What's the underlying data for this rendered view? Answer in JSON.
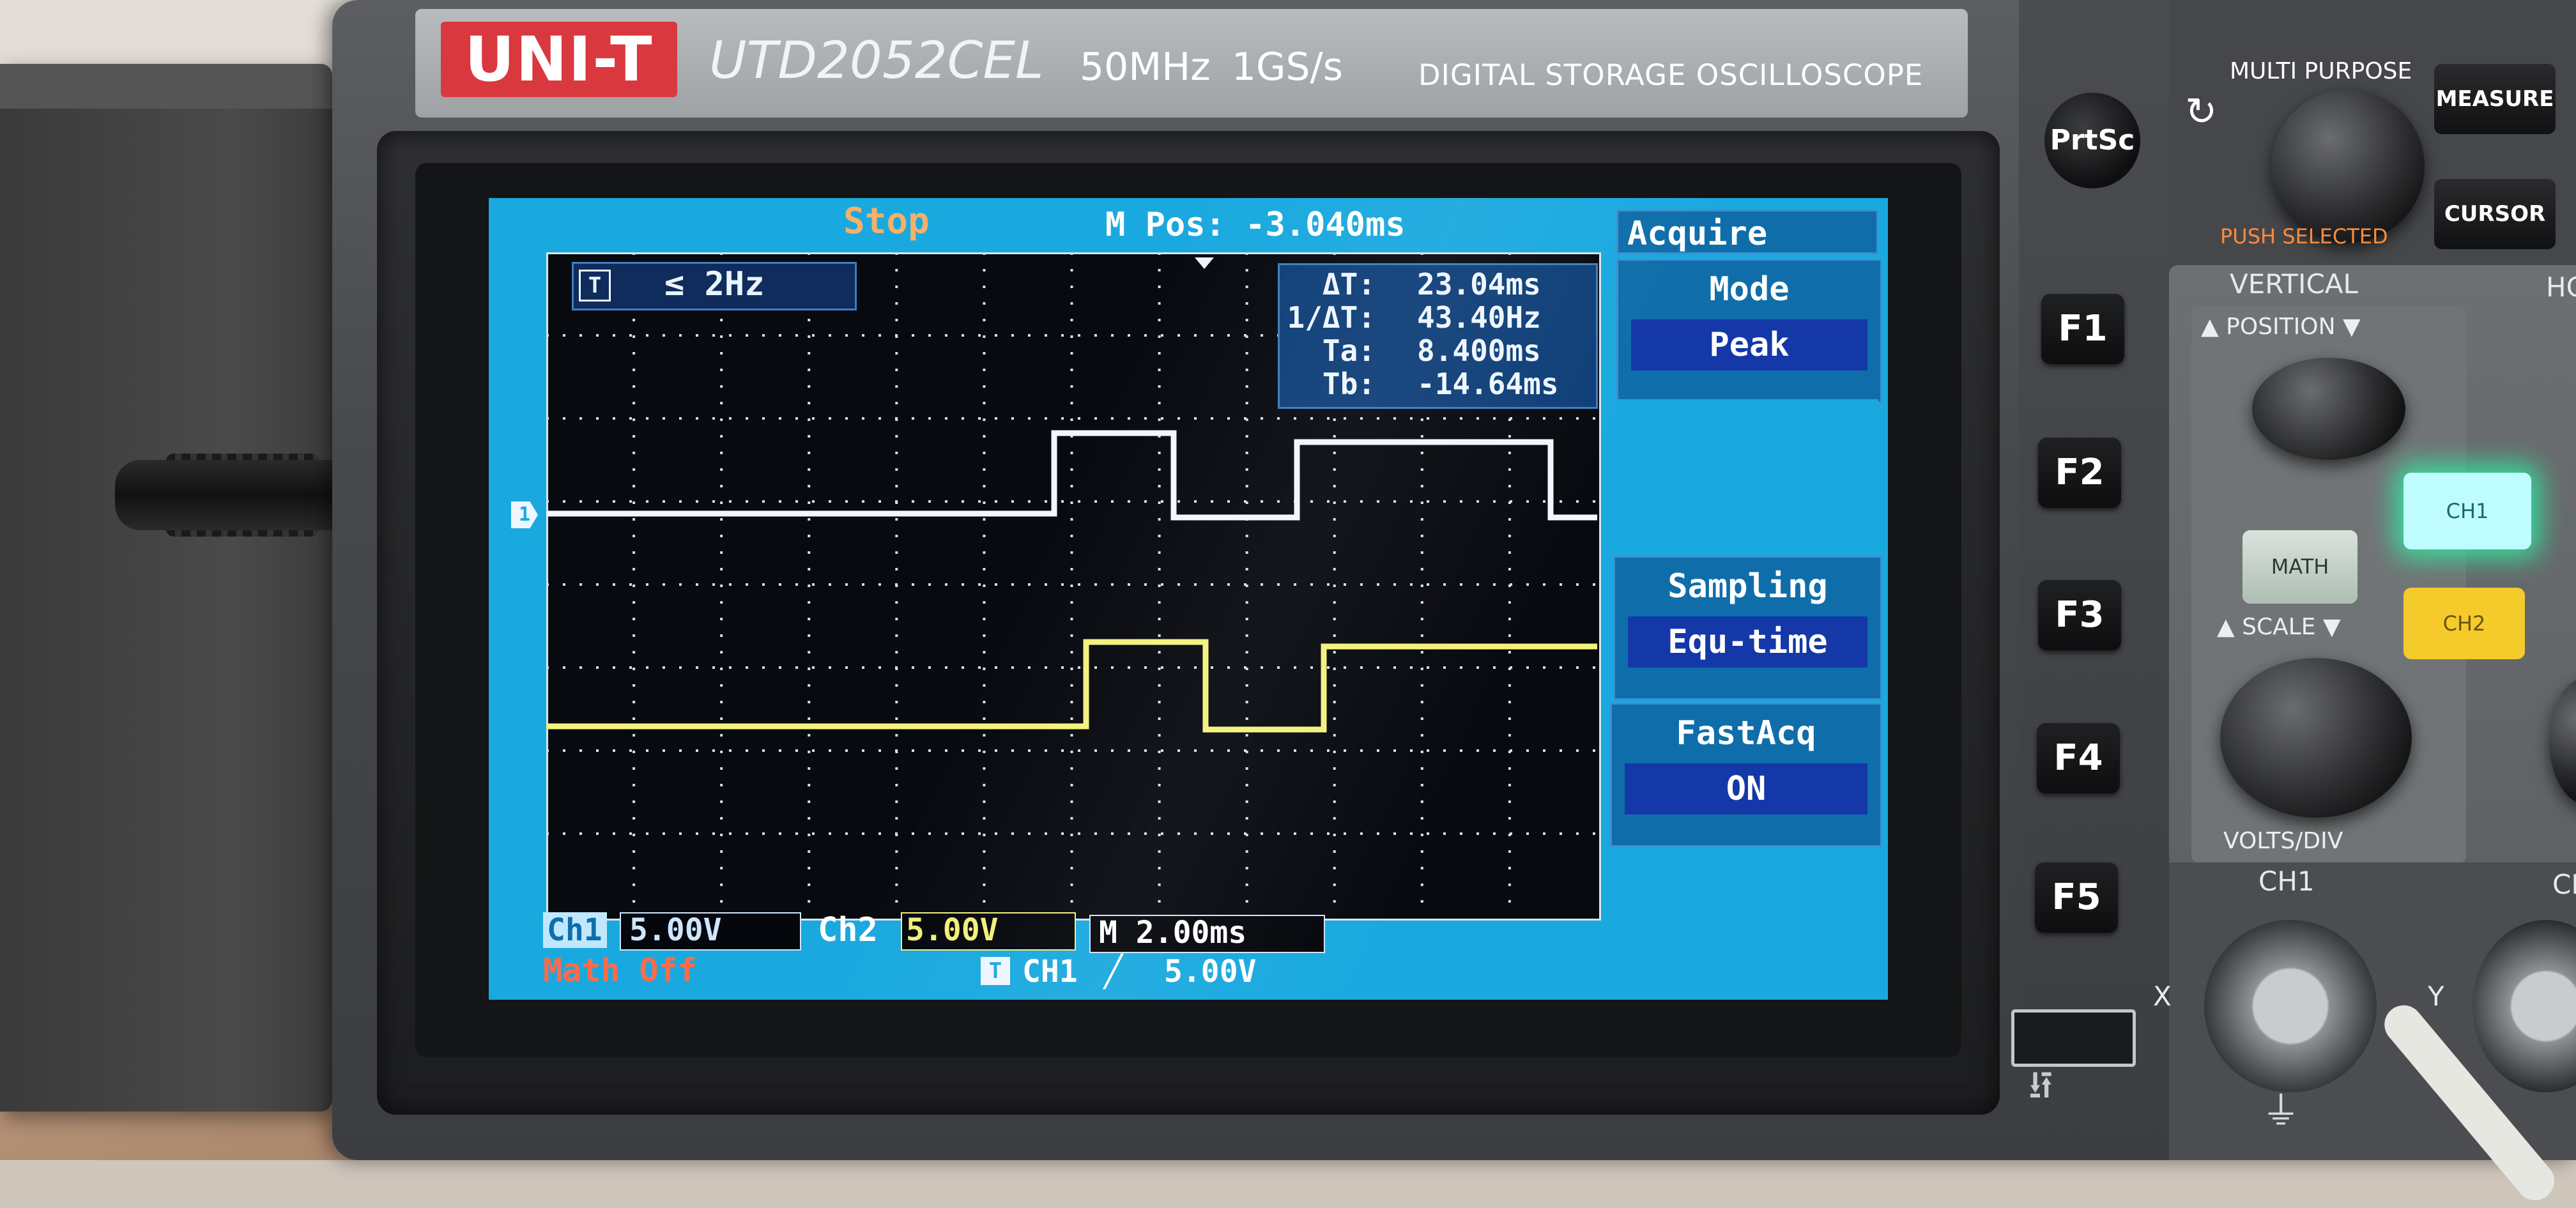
{
  "brand": {
    "logo": "UNI-T",
    "model": "UTD2052CEL",
    "specs": "50MHz 1GS/s",
    "description": "DIGITAL STORAGE OSCILLOSCOPE"
  },
  "screen": {
    "status": "Stop",
    "mpos": "M Pos: -3.040ms",
    "trigger_icon": "T",
    "trigger_readout": "≤ 2Hz",
    "cursors": [
      {
        "name": "ΔT:",
        "value": "23.04ms"
      },
      {
        "name": "1/ΔT:",
        "value": "43.40Hz"
      },
      {
        "name": "Ta:",
        "value": "8.400ms"
      },
      {
        "name": "Tb:",
        "value": "-14.64ms"
      }
    ],
    "ch1_marker": "1",
    "bottom": {
      "ch1_label": "Ch1",
      "ch1_volts": "5.00V",
      "ch2_label": "Ch2",
      "ch2_volts": "5.00V",
      "time_div": "M 2.00ms",
      "math": "Math Off",
      "trigger_icon": "T",
      "trigger_source": "CH1",
      "trigger_slope": "╱",
      "trigger_level": "5.00V"
    },
    "menu": {
      "header": "Acquire",
      "items": [
        {
          "title": "Mode",
          "value": "Peak"
        },
        {
          "title": "Sampling",
          "value": "Equ-time"
        },
        {
          "title": "FastAcq",
          "value": "ON"
        }
      ]
    },
    "colors": {
      "screen_bg": "#1aa9df",
      "ch1_trace": "#f2f6ff",
      "ch2_trace": "#f4f27c",
      "stop": "#f6b069",
      "math_off": "#ff6a4a"
    }
  },
  "panel": {
    "prtsc": "PrtSc",
    "fkeys": [
      "F1",
      "F2",
      "F3",
      "F4",
      "F5"
    ],
    "multi_purpose": "MULTI PURPOSE",
    "push_selected": "PUSH SELECTED",
    "measure": "MEASURE",
    "cursor": "CURSOR",
    "vertical": "VERTICAL",
    "horizontal_partial": "HC",
    "position": "▲ POSITION ▼",
    "scale": "▲ SCALE ▼",
    "volts_div": "VOLTS/DIV",
    "ch1_button": "CH1",
    "ch2_button": "CH2",
    "math_button": "MATH",
    "ch1_connector": "CH1",
    "ch2_connector_partial": "CH",
    "x_label": "X",
    "y_label": "Y",
    "colors": {
      "ch1_led": "#28ffaa",
      "ch2_button": "#f4cb2a",
      "logo_red": "#d9383f"
    }
  },
  "icons": [
    "refresh-icon",
    "usb-icon",
    "trigger-t-icon",
    "rising-edge-icon",
    "ground-icon"
  ]
}
